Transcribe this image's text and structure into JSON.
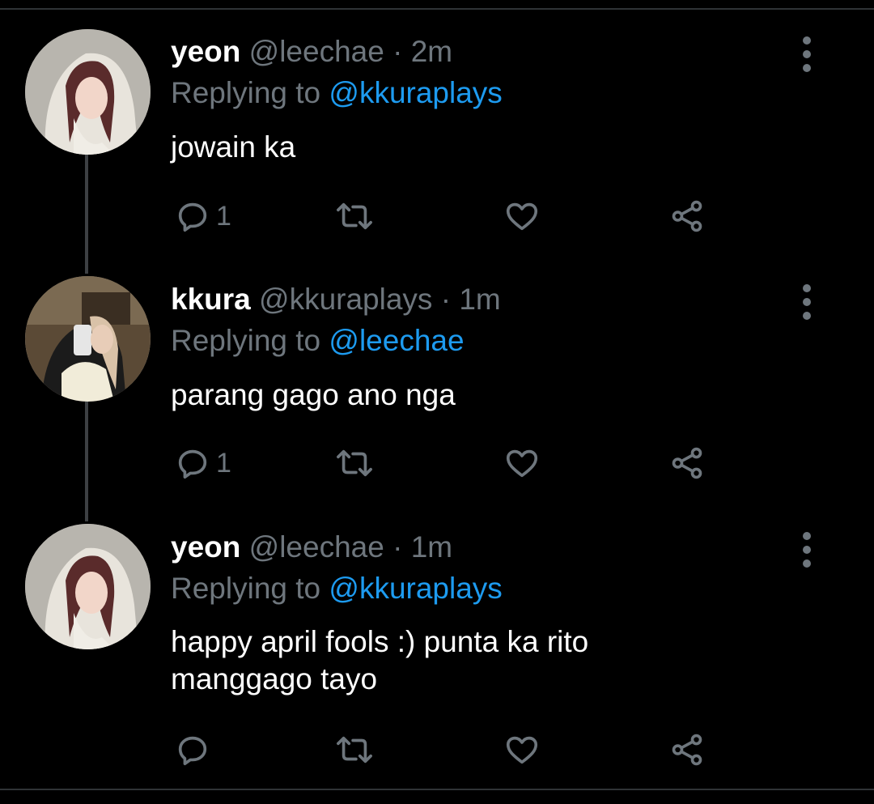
{
  "tweets": [
    {
      "name": "yeon",
      "handle": "@leechae",
      "time": "2m",
      "replying_prefix": "Replying to",
      "replying_to": "@kkuraplays",
      "text": "jowain ka",
      "reply_count": "1"
    },
    {
      "name": "kkura",
      "handle": "@kkuraplays",
      "time": "1m",
      "replying_prefix": "Replying to",
      "replying_to": "@leechae",
      "text": "parang gago ano nga",
      "reply_count": "1"
    },
    {
      "name": "yeon",
      "handle": "@leechae",
      "time": "1m",
      "replying_prefix": "Replying to",
      "replying_to": "@kkuraplays",
      "text": "happy april fools :) punta ka rito manggago tayo",
      "reply_count": ""
    }
  ],
  "separator": "·",
  "icons": [
    "reply-icon",
    "retweet-icon",
    "like-icon",
    "share-icon",
    "more-icon"
  ],
  "colors": {
    "background": "#000000",
    "text": "#ffffff",
    "secondary": "#6e767d",
    "mention": "#1d9bf0"
  }
}
